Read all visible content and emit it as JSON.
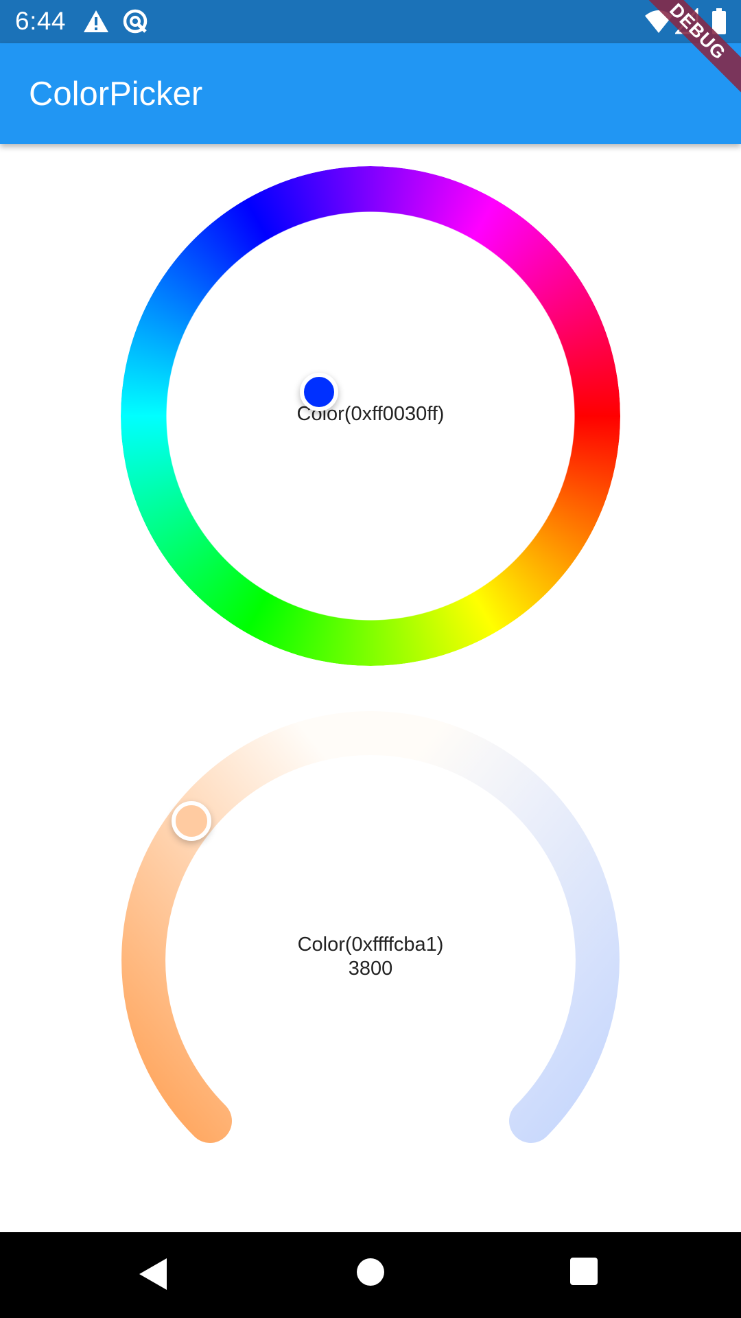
{
  "status_bar": {
    "time": "6:44",
    "icons": [
      "warning-icon",
      "sync-icon",
      "wifi-icon",
      "cell-signal-icon",
      "battery-icon"
    ]
  },
  "app_bar": {
    "title": "ColorPicker"
  },
  "debug_banner": {
    "label": "DEBUG"
  },
  "wheel_picker": {
    "value_text": "Color(0xff0030ff)",
    "selected_color": "#0030ff",
    "thumb_hue_degrees": 228
  },
  "temperature_picker": {
    "value_text": "Color(0xffffcba1)",
    "temperature_text": "3800",
    "selected_color": "#ffcba1",
    "warm_end_color": "#ffa257",
    "neutral_color": "#fffcf8",
    "cool_end_color": "#c5d6fd",
    "position_fraction": 0.307
  },
  "nav_bar": {
    "buttons": [
      "back-icon",
      "home-icon",
      "recents-icon"
    ]
  }
}
